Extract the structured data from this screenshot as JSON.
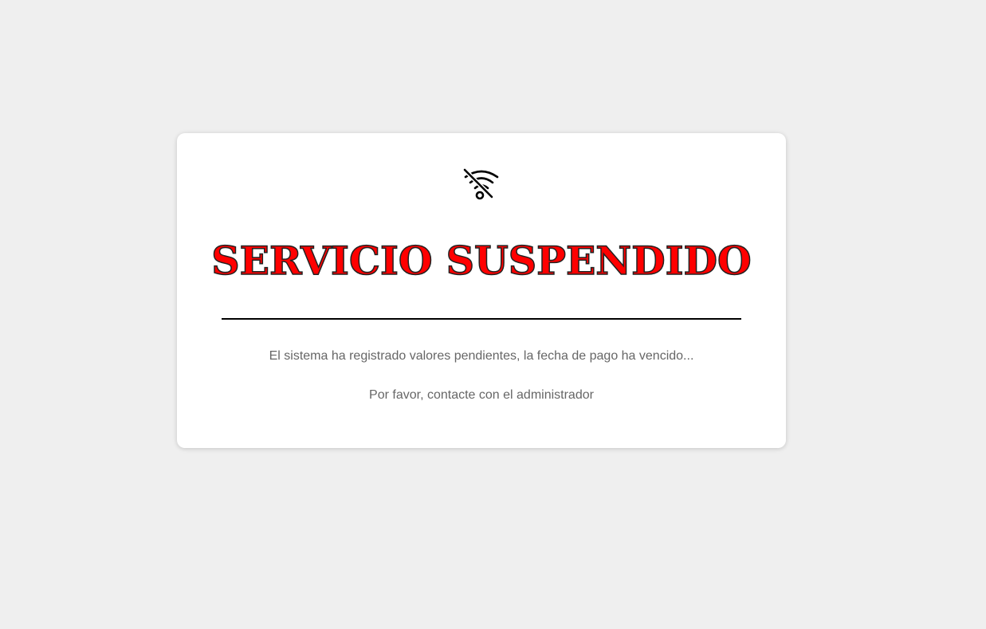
{
  "page": {
    "background_color": "#efefef"
  },
  "card": {
    "icon": "wifi-off-icon",
    "title": "SERVICIO SUSPENDIDO",
    "title_color": "#ff0000",
    "message_primary": "El sistema ha registrado valores pendientes, la fecha de pago ha vencido...",
    "message_secondary": "Por favor, contacte con el administrador",
    "message_color": "#666666"
  }
}
